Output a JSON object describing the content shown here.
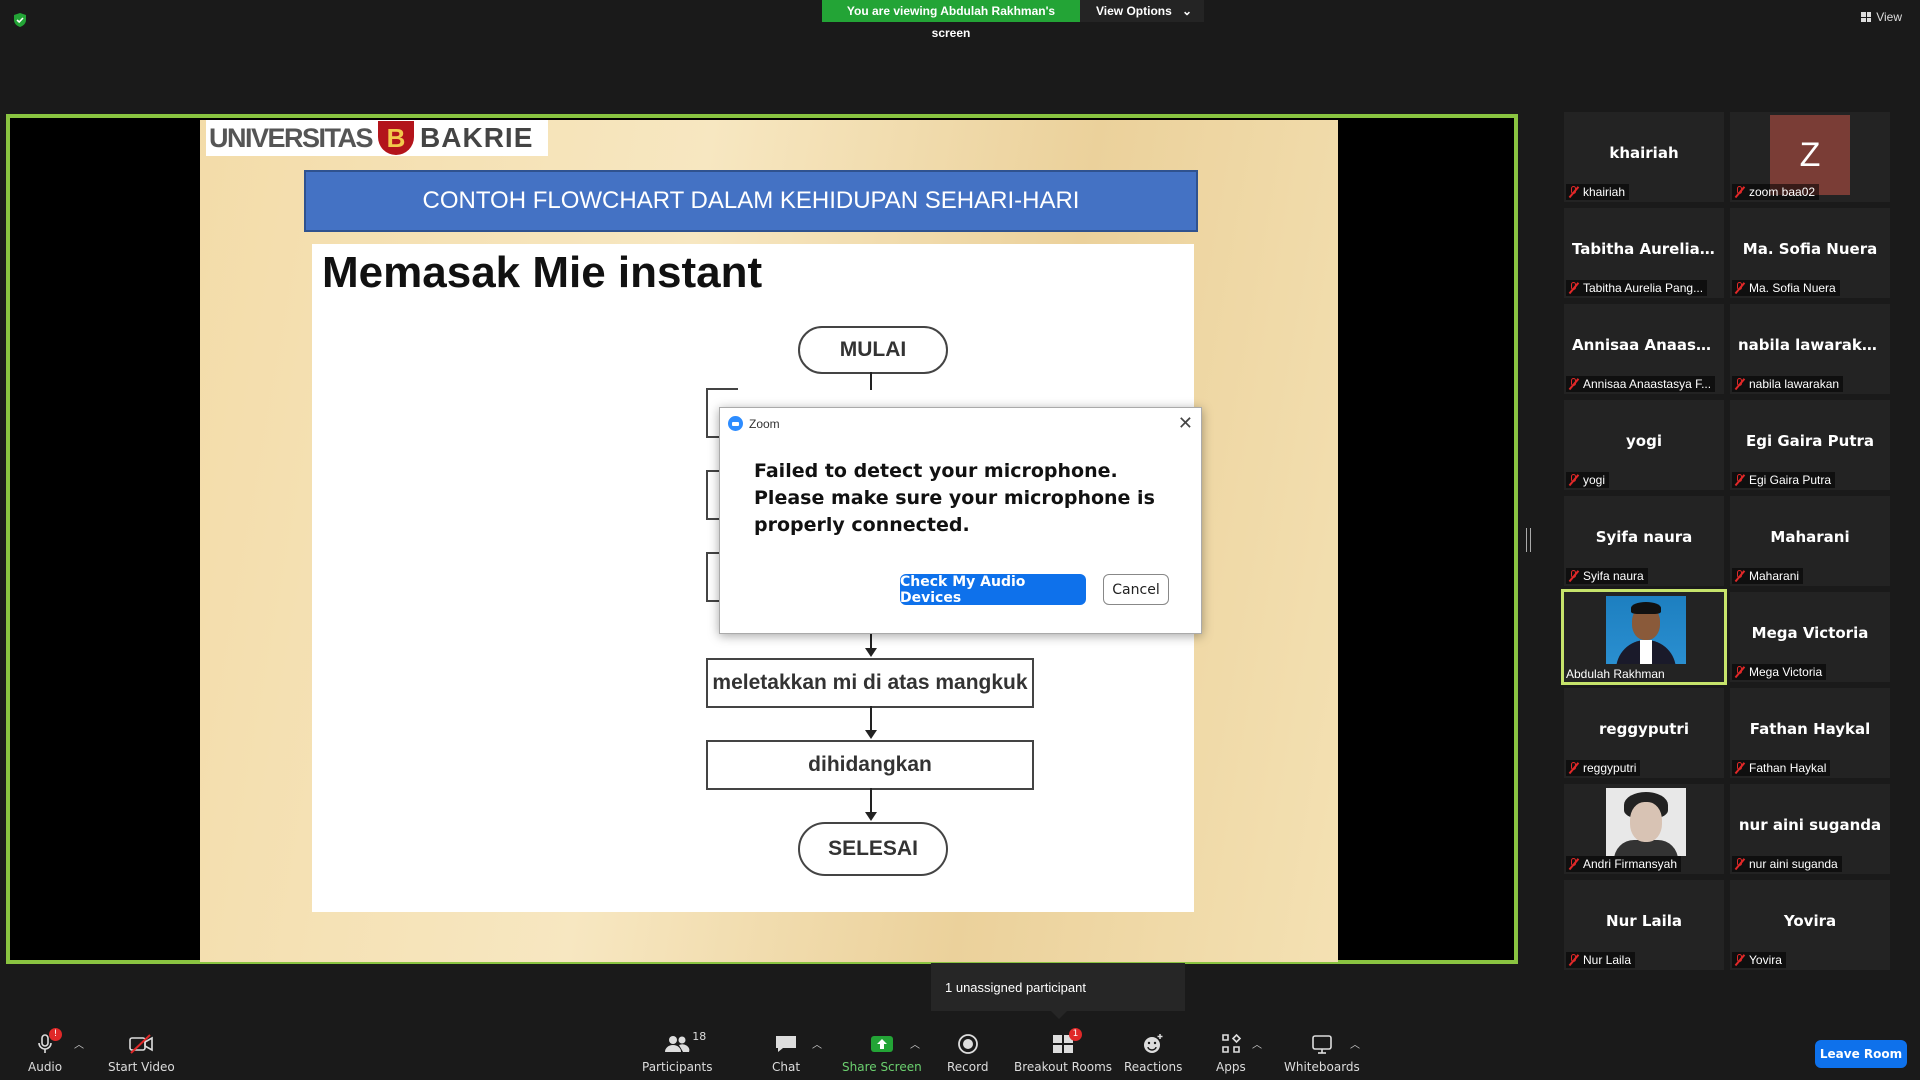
{
  "top": {
    "banner_text": "You are viewing Abdulah Rakhman's screen",
    "view_options_label": "View Options",
    "view_label": "View"
  },
  "slide": {
    "logo_left": "UNIVERSITAS",
    "logo_mark": "B",
    "logo_right": "BAKRIE",
    "title": "CONTOH FLOWCHART DALAM KEHIDUPAN SEHARI-HARI",
    "heading": "Memasak Mie instant",
    "flow": {
      "start": "MULAI",
      "step_place": "meletakkan mi di atas mangkuk",
      "step_serve": "dihidangkan",
      "end": "SELESAI"
    }
  },
  "dialog": {
    "app_name": "Zoom",
    "message": "Failed to detect your microphone. Please make sure your microphone is properly connected.",
    "primary_label": "Check My Audio Devices",
    "cancel_label": "Cancel",
    "close_symbol": "✕"
  },
  "gallery": [
    {
      "name": "khairiah",
      "label": "khairiah"
    },
    {
      "name": "",
      "label": "zoom baa02",
      "avatar_letter": "Z"
    },
    {
      "name": "Tabitha  Aurelia...",
      "label": "Tabitha Aurelia Pang..."
    },
    {
      "name": "Ma. Sofia Nuera",
      "label": "Ma. Sofia Nuera"
    },
    {
      "name": "Annisaa  Anaast...",
      "label": "Annisaa Anaastasya F..."
    },
    {
      "name": "nabila lawarakan",
      "label": "nabila lawarakan"
    },
    {
      "name": "yogi",
      "label": "yogi"
    },
    {
      "name": "Egi Gaira Putra",
      "label": "Egi Gaira Putra"
    },
    {
      "name": "Syifa naura",
      "label": "Syifa naura"
    },
    {
      "name": "Maharani",
      "label": "Maharani"
    },
    {
      "name": "",
      "label": "Abdulah Rakhman"
    },
    {
      "name": "Mega Victoria",
      "label": "Mega Victoria"
    },
    {
      "name": "reggyputri",
      "label": "reggyputri"
    },
    {
      "name": "Fathan Haykal",
      "label": "Fathan Haykal"
    },
    {
      "name": "",
      "label": "Andri Firmansyah"
    },
    {
      "name": "nur aini suganda",
      "label": "nur aini suganda"
    },
    {
      "name": "Nur Laila",
      "label": "Nur Laila"
    },
    {
      "name": "Yovira",
      "label": "Yovira"
    }
  ],
  "toast": "1 unassigned participant",
  "toolbar": {
    "audio": "Audio",
    "audio_badge": "!",
    "start_video": "Start Video",
    "participants": "Participants",
    "participants_count": "18",
    "chat": "Chat",
    "share_screen": "Share Screen",
    "record": "Record",
    "breakout_rooms": "Breakout Rooms",
    "breakout_badge": "1",
    "reactions": "Reactions",
    "apps": "Apps",
    "whiteboards": "Whiteboards",
    "leave_room": "Leave Room"
  },
  "colors": {
    "active_speaker_border": "#8ac441",
    "banner_green": "#23a436",
    "primary_blue": "#0e71eb",
    "muted_red": "#e02828"
  }
}
